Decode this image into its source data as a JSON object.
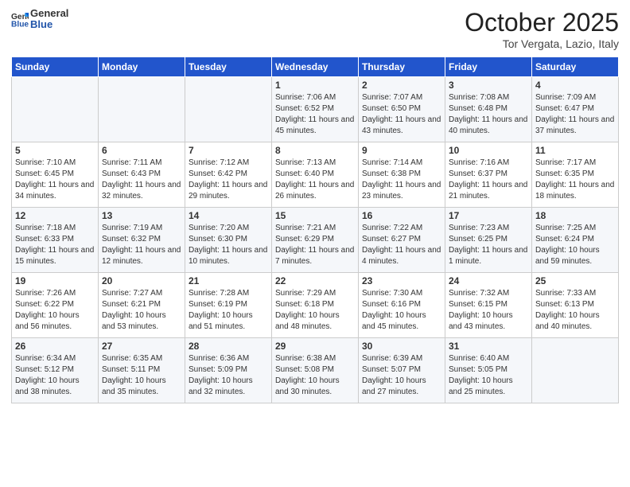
{
  "header": {
    "logo_general": "General",
    "logo_blue": "Blue",
    "title": "October 2025",
    "location": "Tor Vergata, Lazio, Italy"
  },
  "days_of_week": [
    "Sunday",
    "Monday",
    "Tuesday",
    "Wednesday",
    "Thursday",
    "Friday",
    "Saturday"
  ],
  "weeks": [
    [
      {
        "num": "",
        "sunrise": "",
        "sunset": "",
        "daylight": ""
      },
      {
        "num": "",
        "sunrise": "",
        "sunset": "",
        "daylight": ""
      },
      {
        "num": "",
        "sunrise": "",
        "sunset": "",
        "daylight": ""
      },
      {
        "num": "1",
        "sunrise": "7:06 AM",
        "sunset": "6:52 PM",
        "daylight": "11 hours and 45 minutes."
      },
      {
        "num": "2",
        "sunrise": "7:07 AM",
        "sunset": "6:50 PM",
        "daylight": "11 hours and 43 minutes."
      },
      {
        "num": "3",
        "sunrise": "7:08 AM",
        "sunset": "6:48 PM",
        "daylight": "11 hours and 40 minutes."
      },
      {
        "num": "4",
        "sunrise": "7:09 AM",
        "sunset": "6:47 PM",
        "daylight": "11 hours and 37 minutes."
      }
    ],
    [
      {
        "num": "5",
        "sunrise": "7:10 AM",
        "sunset": "6:45 PM",
        "daylight": "11 hours and 34 minutes."
      },
      {
        "num": "6",
        "sunrise": "7:11 AM",
        "sunset": "6:43 PM",
        "daylight": "11 hours and 32 minutes."
      },
      {
        "num": "7",
        "sunrise": "7:12 AM",
        "sunset": "6:42 PM",
        "daylight": "11 hours and 29 minutes."
      },
      {
        "num": "8",
        "sunrise": "7:13 AM",
        "sunset": "6:40 PM",
        "daylight": "11 hours and 26 minutes."
      },
      {
        "num": "9",
        "sunrise": "7:14 AM",
        "sunset": "6:38 PM",
        "daylight": "11 hours and 23 minutes."
      },
      {
        "num": "10",
        "sunrise": "7:16 AM",
        "sunset": "6:37 PM",
        "daylight": "11 hours and 21 minutes."
      },
      {
        "num": "11",
        "sunrise": "7:17 AM",
        "sunset": "6:35 PM",
        "daylight": "11 hours and 18 minutes."
      }
    ],
    [
      {
        "num": "12",
        "sunrise": "7:18 AM",
        "sunset": "6:33 PM",
        "daylight": "11 hours and 15 minutes."
      },
      {
        "num": "13",
        "sunrise": "7:19 AM",
        "sunset": "6:32 PM",
        "daylight": "11 hours and 12 minutes."
      },
      {
        "num": "14",
        "sunrise": "7:20 AM",
        "sunset": "6:30 PM",
        "daylight": "11 hours and 10 minutes."
      },
      {
        "num": "15",
        "sunrise": "7:21 AM",
        "sunset": "6:29 PM",
        "daylight": "11 hours and 7 minutes."
      },
      {
        "num": "16",
        "sunrise": "7:22 AM",
        "sunset": "6:27 PM",
        "daylight": "11 hours and 4 minutes."
      },
      {
        "num": "17",
        "sunrise": "7:23 AM",
        "sunset": "6:25 PM",
        "daylight": "11 hours and 1 minute."
      },
      {
        "num": "18",
        "sunrise": "7:25 AM",
        "sunset": "6:24 PM",
        "daylight": "10 hours and 59 minutes."
      }
    ],
    [
      {
        "num": "19",
        "sunrise": "7:26 AM",
        "sunset": "6:22 PM",
        "daylight": "10 hours and 56 minutes."
      },
      {
        "num": "20",
        "sunrise": "7:27 AM",
        "sunset": "6:21 PM",
        "daylight": "10 hours and 53 minutes."
      },
      {
        "num": "21",
        "sunrise": "7:28 AM",
        "sunset": "6:19 PM",
        "daylight": "10 hours and 51 minutes."
      },
      {
        "num": "22",
        "sunrise": "7:29 AM",
        "sunset": "6:18 PM",
        "daylight": "10 hours and 48 minutes."
      },
      {
        "num": "23",
        "sunrise": "7:30 AM",
        "sunset": "6:16 PM",
        "daylight": "10 hours and 45 minutes."
      },
      {
        "num": "24",
        "sunrise": "7:32 AM",
        "sunset": "6:15 PM",
        "daylight": "10 hours and 43 minutes."
      },
      {
        "num": "25",
        "sunrise": "7:33 AM",
        "sunset": "6:13 PM",
        "daylight": "10 hours and 40 minutes."
      }
    ],
    [
      {
        "num": "26",
        "sunrise": "6:34 AM",
        "sunset": "5:12 PM",
        "daylight": "10 hours and 38 minutes."
      },
      {
        "num": "27",
        "sunrise": "6:35 AM",
        "sunset": "5:11 PM",
        "daylight": "10 hours and 35 minutes."
      },
      {
        "num": "28",
        "sunrise": "6:36 AM",
        "sunset": "5:09 PM",
        "daylight": "10 hours and 32 minutes."
      },
      {
        "num": "29",
        "sunrise": "6:38 AM",
        "sunset": "5:08 PM",
        "daylight": "10 hours and 30 minutes."
      },
      {
        "num": "30",
        "sunrise": "6:39 AM",
        "sunset": "5:07 PM",
        "daylight": "10 hours and 27 minutes."
      },
      {
        "num": "31",
        "sunrise": "6:40 AM",
        "sunset": "5:05 PM",
        "daylight": "10 hours and 25 minutes."
      },
      {
        "num": "",
        "sunrise": "",
        "sunset": "",
        "daylight": ""
      }
    ]
  ]
}
